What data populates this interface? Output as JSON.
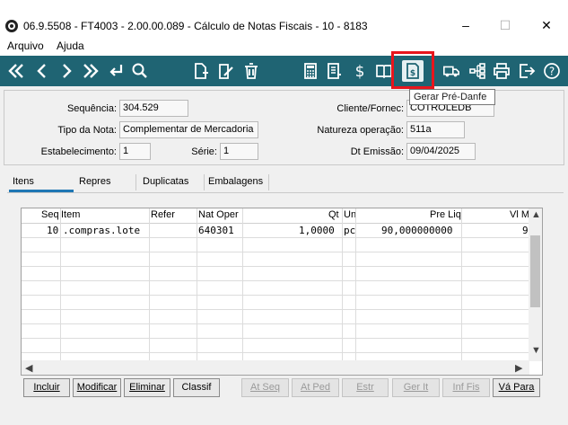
{
  "window": {
    "title": "06.9.5508 - FT4003 - 2.00.00.089 - Cálculo de Notas Fiscais - 10 - 8183",
    "minimize": "–",
    "maximize": "☐",
    "close": "✕"
  },
  "menu": {
    "items": [
      "Arquivo",
      "Ajuda"
    ]
  },
  "toolbar": {
    "tooltip": "Gerar Pré-Danfe"
  },
  "header": {
    "sequencia_label": "Sequência:",
    "sequencia_value": "304.529",
    "tipo_nota_label": "Tipo da Nota:",
    "tipo_nota_value": "Complementar de Mercadoria",
    "estabelecimento_label": "Estabelecimento:",
    "estabelecimento_value": "1",
    "serie_label": "Série:",
    "serie_value": "1",
    "cliente_label": "Cliente/Fornec:",
    "cliente_value": "COTROLEDB",
    "natureza_label": "Natureza operação:",
    "natureza_value": "511a",
    "dt_emissao_label": "Dt Emissão:",
    "dt_emissao_value": "09/04/2025"
  },
  "tabs": [
    "Itens",
    "Repres",
    "Duplicatas",
    "Embalagens"
  ],
  "grid": {
    "columns": [
      "Seq",
      "Item",
      "Refer",
      "Nat Oper",
      "Qt",
      "Un",
      "Pre Liq",
      "Vl M"
    ],
    "rows": [
      {
        "seq": "10",
        "item": ".compras.lote",
        "refer": "",
        "nat_oper": "640301",
        "qt": "1,0000",
        "un": "pc",
        "pre_liq": "90,000000000",
        "vl_m": "9"
      }
    ]
  },
  "buttons": {
    "incluir": "Incluir",
    "modificar": "Modificar",
    "eliminar": "Eliminar",
    "classif": "Classif",
    "at_seq": "At Seq",
    "at_ped": "At Ped",
    "estr": "Estr",
    "ger_it": "Ger It",
    "inf_fis": "Inf Fis",
    "va_para": "Vá Para"
  },
  "colors": {
    "toolbar": "#1f6473",
    "highlight": "#e8151c",
    "tab_accent": "#1f77b4"
  }
}
